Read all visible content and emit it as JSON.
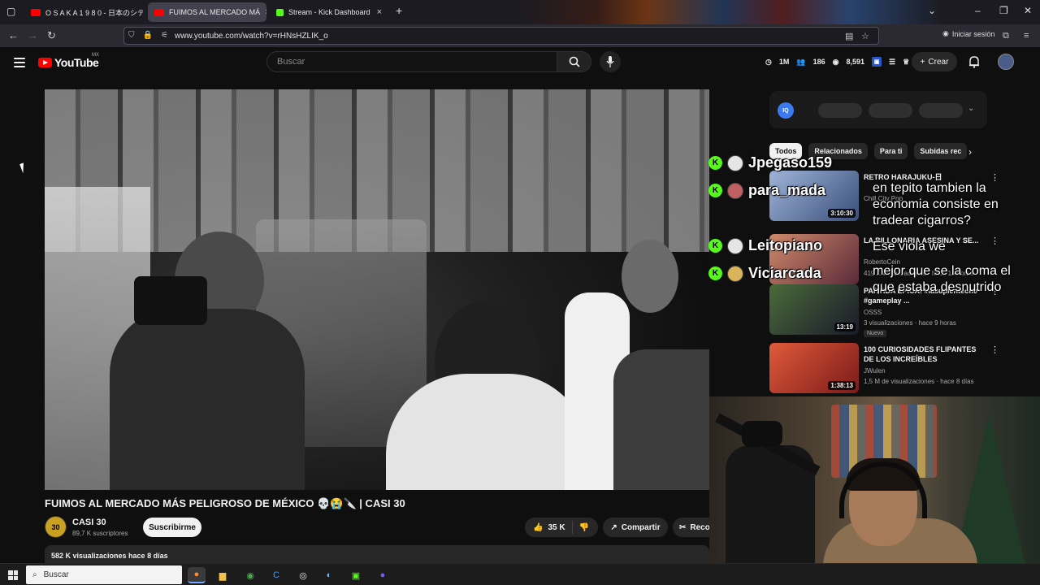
{
  "browser": {
    "tabs": [
      {
        "label": "O S A K A 1 9 8 0 - 日本のシティ",
        "favicon_color": "#ff0000",
        "active": false
      },
      {
        "label": "FUIMOS AL MERCADO MÁ",
        "favicon_color": "#ff0000",
        "active": true
      },
      {
        "label": "Stream - Kick Dashboard",
        "favicon_color": "#53fc18",
        "active": false
      }
    ],
    "new_tab_icon": "plus-icon",
    "url": "www.youtube.com/watch?v=rHNsHZLIK_o",
    "signin_label": "Iniciar sesión"
  },
  "youtube": {
    "logo_text": "YouTube",
    "country_code": "MX",
    "search_placeholder": "Buscar",
    "ext_stats": {
      "views": "1M",
      "viewers": "186",
      "count": "8,591"
    },
    "create_label": "Crear"
  },
  "video": {
    "title": "FUIMOS AL MERCADO MÁS PELIGROSO DE MÉXICO 💀😭🔪 | CASI 30",
    "channel": {
      "name": "CASI 30",
      "subscribers": "89,7 K suscriptores",
      "avatar_text": "30"
    },
    "subscribe_label": "Suscribirme",
    "likes": "35 K",
    "share_label": "Compartir",
    "clip_label": "Recortar",
    "description_meta": "582 K visualizaciones  hace 8 días"
  },
  "chat": {
    "users": [
      "Jpegaso159",
      "para_mada",
      "Leitopiano",
      "Viciarcada"
    ],
    "messages": [
      "en tepito tambien la economia consiste en tradear cigarros?",
      "Ese viola we",
      "mejor que se la coma el que estaba desnutrido"
    ],
    "accent": "#53fc18"
  },
  "sidebar": {
    "chips": [
      "Todos",
      "Relacionados",
      "Para ti",
      "Subidas rec"
    ],
    "recommendations": [
      {
        "title": "RETRO HARAJUKU-日",
        "channel": "Chill City Pop",
        "meta": "",
        "duration": "3:10:30",
        "thumb": "#6b7fa8"
      },
      {
        "title": "LA BILLONARIA ASESINA Y SE...",
        "channel": "RobertoCein",
        "meta": "419 K visualizaciones · hace 10 horas",
        "duration": "",
        "thumb": "#8a4a5a"
      },
      {
        "title": "PARTIDA ÉPICA! #lasuplenteone #gameplay ...",
        "channel": "OSSS",
        "meta": "3 visualizaciones · hace 9 horas",
        "duration": "13:19",
        "new_label": "Nuevo",
        "thumb": "#2a3a2a"
      },
      {
        "title": "100 CURIOSIDADES FLIPANTES DE LOS INCREÍBLES",
        "channel": "JWulen",
        "meta": "1,5 M de visualizaciones · hace 8 días",
        "duration": "1:38:13",
        "thumb": "#c0392b"
      }
    ]
  },
  "taskbar": {
    "search_label": "Buscar",
    "apps": [
      "firefox-icon",
      "file-explorer-icon",
      "chrome-icon",
      "app-c-icon",
      "obs-icon",
      "steam-icon",
      "kick-icon",
      "discord-icon"
    ]
  }
}
